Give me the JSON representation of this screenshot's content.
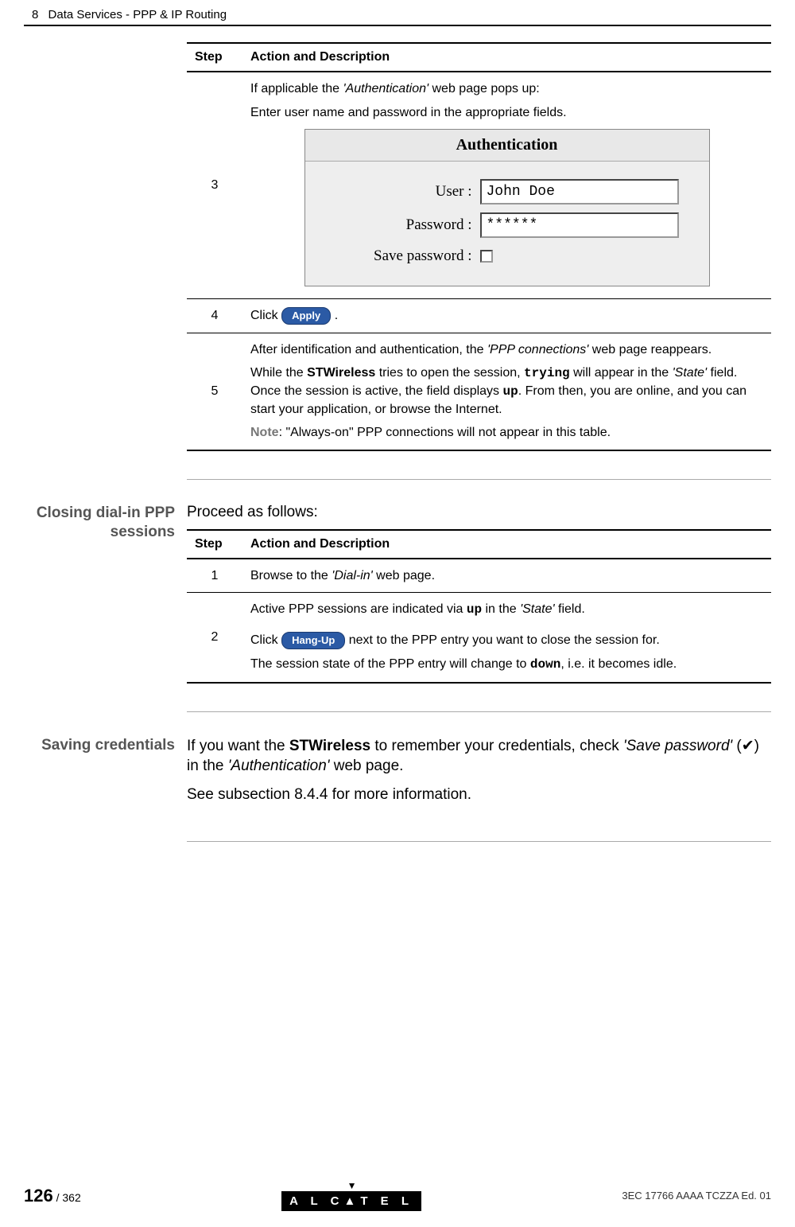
{
  "header": {
    "chapter_num": "8",
    "chapter_title": "Data Services - PPP & IP Routing"
  },
  "table1": {
    "col_step": "Step",
    "col_action": "Action and Description",
    "rows": [
      {
        "num": "3",
        "line1a": "If applicable the ",
        "line1b": "'Authentication'",
        "line1c": " web page pops up:",
        "line2": "Enter user name and password in the appropriate fields.",
        "auth": {
          "title": "Authentication",
          "user_label": "User :",
          "user_value": "John Doe",
          "pass_label": "Password :",
          "pass_value": "******",
          "save_label": "Save password :"
        }
      },
      {
        "num": "4",
        "prefix": "Click",
        "button": "Apply",
        "suffix": " ."
      },
      {
        "num": "5",
        "p1a": "After identification and authentication, the ",
        "p1b": "'PPP connections'",
        "p1c": " web page reappears.",
        "p2a": "While the ",
        "p2b": "STWireless",
        "p2c": " tries to open the session, ",
        "p2d": "trying",
        "p2e": " will appear in the ",
        "p2f": "'State'",
        "p2g": " field. Once the session is active, the field displays ",
        "p2h": "up",
        "p2i": ". From then, you are online, and you can start your application, or browse the Internet.",
        "note_label": "Note",
        "note_text": ": \"Always-on\" PPP connections will not appear in this table."
      }
    ]
  },
  "section2": {
    "heading": "Closing dial-in PPP sessions",
    "lead": "Proceed as follows:",
    "table": {
      "col_step": "Step",
      "col_action": "Action and Description",
      "r1": {
        "num": "1",
        "a": "Browse to the ",
        "b": "'Dial-in'",
        "c": " web page."
      },
      "r2": {
        "num": "2",
        "p1a": "Active PPP sessions are indicated via ",
        "p1b": "up",
        "p1c": " in the ",
        "p1d": "'State'",
        "p1e": " field.",
        "p2a": "Click",
        "btn": "Hang-Up",
        "p2b": "  next to the PPP entry you want to close the session for.",
        "p3a": "The session state of the PPP entry will change to ",
        "p3b": "down",
        "p3c": ", i.e. it becomes idle."
      }
    }
  },
  "section3": {
    "heading": "Saving credentials",
    "p1a": "If you want the ",
    "p1b": "STWireless",
    "p1c": " to remember your credentials, check ",
    "p1d": "'Save password'",
    "p1e": " (",
    "p1f": ") in the ",
    "p1g": "'Authentication'",
    "p1h": " web page.",
    "p2": "See subsection 8.4.4 for more information."
  },
  "footer": {
    "page_big": "126",
    "page_total": " / 362",
    "logo_pre": "A L C",
    "logo_post": "T E L",
    "docref": "3EC 17766 AAAA TCZZA Ed. 01"
  }
}
